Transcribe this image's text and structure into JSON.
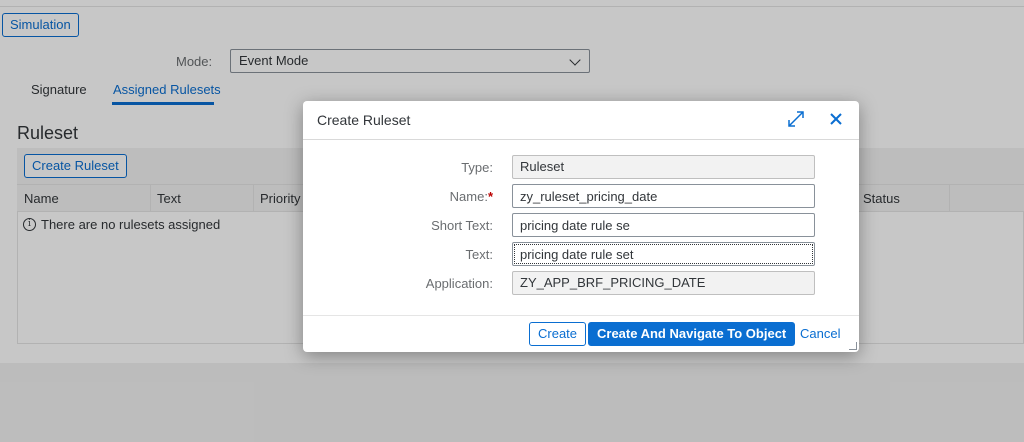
{
  "toolbar": {
    "simulation_label": "Simulation"
  },
  "mode": {
    "label": "Mode:",
    "value": "Event Mode"
  },
  "tabs": [
    {
      "label": "Signature",
      "active": false
    },
    {
      "label": "Assigned Rulesets",
      "active": true
    }
  ],
  "ruleset": {
    "title": "Ruleset",
    "create_button": "Create Ruleset",
    "columns": [
      "Name",
      "Text",
      "Priority",
      "Status"
    ],
    "empty_text": "There are no rulesets assigned",
    "empty_icon": "info-icon"
  },
  "dialog": {
    "title": "Create Ruleset",
    "expand_icon": "expand-icon",
    "close_icon": "close-icon",
    "fields": {
      "type": {
        "label": "Type:",
        "value": "Ruleset"
      },
      "name": {
        "label": "Name:",
        "required_mark": "*",
        "value": "zy_ruleset_pricing_date"
      },
      "short_text": {
        "label": "Short Text:",
        "value": "pricing date rule se"
      },
      "text": {
        "label": "Text:",
        "value": "pricing date rule set"
      },
      "application": {
        "label": "Application:",
        "value": "ZY_APP_BRF_PRICING_DATE"
      }
    },
    "buttons": {
      "create": "Create",
      "create_navigate": "Create And Navigate To Object",
      "cancel": "Cancel"
    }
  },
  "colors": {
    "accent": "#0a6ed1",
    "required": "#bb0000",
    "text": "#32363a"
  }
}
